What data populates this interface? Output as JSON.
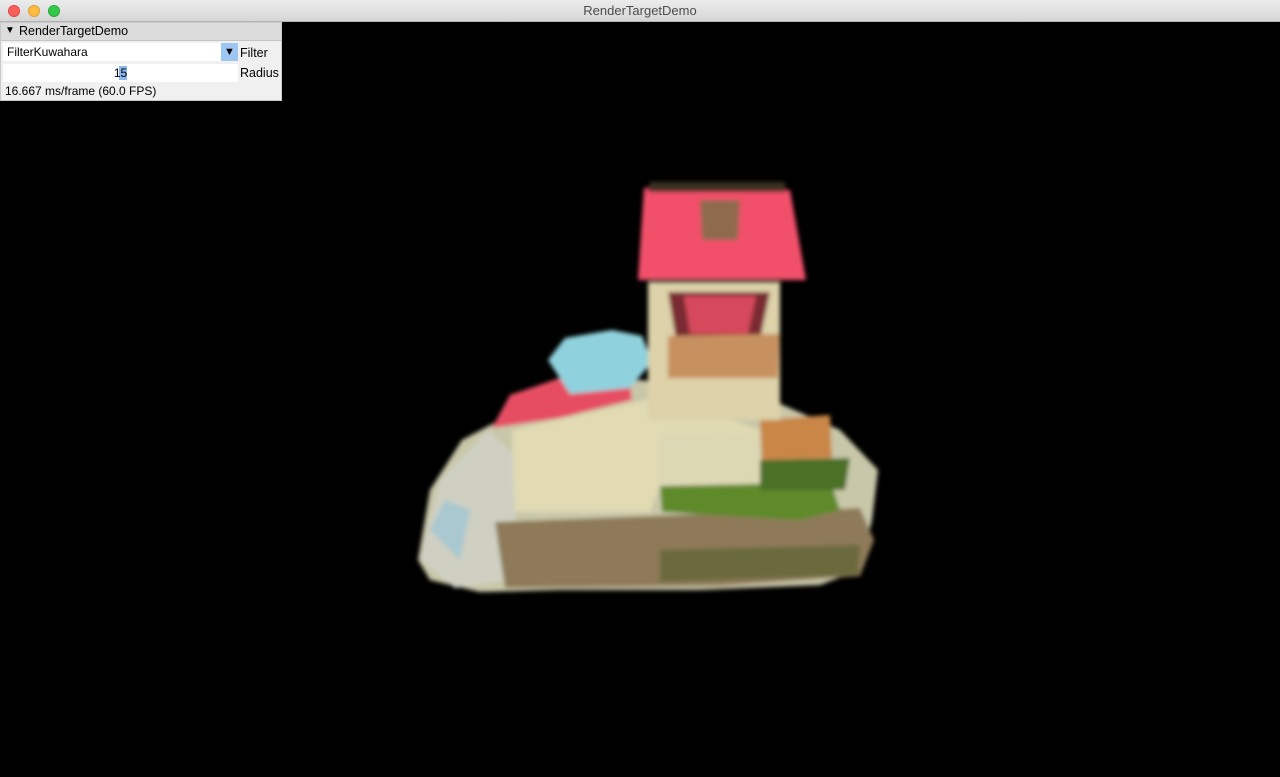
{
  "window": {
    "title": "RenderTargetDemo"
  },
  "panel": {
    "title": "RenderTargetDemo",
    "filter": {
      "value": "FilterKuwahara",
      "label": "Filter"
    },
    "radius": {
      "value": "15",
      "label": "Radius"
    },
    "fps_text": "16.667 ms/frame (60.0 FPS)"
  },
  "icons": {
    "collapse": "triangle-down-icon",
    "dropdown": "triangle-down-icon"
  },
  "colors": {
    "accent": "#9ec6f2",
    "viewport_background": "#000000"
  }
}
